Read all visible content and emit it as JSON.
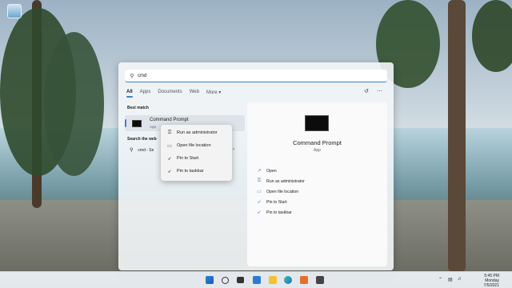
{
  "colors": {
    "accent": "#3f7ed0",
    "panel": "#f3f6f8",
    "taskbar": "#e8ecf0"
  },
  "search": {
    "icon": "search-icon",
    "query": "cmd"
  },
  "tabs": [
    {
      "label": "All",
      "active": true
    },
    {
      "label": "Apps"
    },
    {
      "label": "Documents"
    },
    {
      "label": "Web"
    },
    {
      "label": "More ▾"
    }
  ],
  "tab_tools": {
    "share_icon": "share-icon",
    "more_icon": "ellipsis-icon"
  },
  "best_match": {
    "section_label": "Best match",
    "title": "Command Prompt",
    "subtitle": "App"
  },
  "web_search": {
    "section_label": "Search the web",
    "text": "cmd - Se"
  },
  "context_menu": [
    {
      "label": "Run as administrator",
      "icon": "shield-icon"
    },
    {
      "label": "Open file location",
      "icon": "folder-icon"
    },
    {
      "label": "Pin to Start",
      "icon": "pin-icon"
    },
    {
      "label": "Pin to taskbar",
      "icon": "pin-icon"
    }
  ],
  "preview": {
    "title": "Command Prompt",
    "subtitle": "App",
    "actions": [
      {
        "label": "Open",
        "icon": "open-icon"
      },
      {
        "label": "Run as administrator",
        "icon": "shield-icon"
      },
      {
        "label": "Open file location",
        "icon": "folder-icon"
      },
      {
        "label": "Pin to Start",
        "icon": "pin-icon"
      },
      {
        "label": "Pin to taskbar",
        "icon": "pin-icon"
      }
    ]
  },
  "taskbar": {
    "icons": [
      "windows-start-icon",
      "search-icon",
      "task-view-icon",
      "widgets-icon",
      "file-explorer-icon",
      "edge-icon",
      "store-icon",
      "app-icon"
    ],
    "tray_icons": [
      "chevron-up-icon",
      "network-icon",
      "volume-icon"
    ],
    "clock": {
      "time": "5:45 PM",
      "day": "Monday",
      "date": "7/5/2021"
    }
  }
}
